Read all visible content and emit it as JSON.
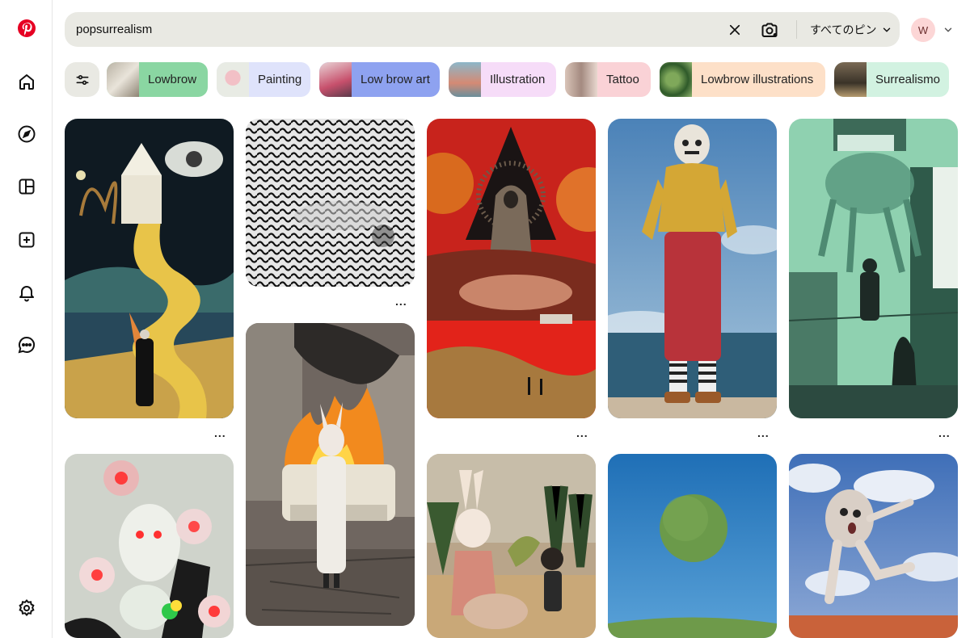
{
  "search": {
    "value": "popsurrealism",
    "filter_label": "すべてのピン"
  },
  "account": {
    "initial": "W"
  },
  "chips": [
    {
      "label": "Lowbrow",
      "color": "#8ad6a2"
    },
    {
      "label": "Painting",
      "color": "#dfe3fb"
    },
    {
      "label": "Low brow art",
      "color": "#8ea2f0"
    },
    {
      "label": "Illustration",
      "color": "#f6dcf8"
    },
    {
      "label": "Tattoo",
      "color": "#fad2d6"
    },
    {
      "label": "Lowbrow illustrations",
      "color": "#fde0c8"
    },
    {
      "label": "Surrealismo",
      "color": "#d2f2e1"
    }
  ],
  "pin_more": "...",
  "colors": {
    "brand": "#e60023",
    "search_bg": "#e9e9e3"
  },
  "icons": [
    "pinterest-logo-icon",
    "home-icon",
    "compass-icon",
    "boards-icon",
    "create-icon",
    "bell-icon",
    "messages-icon",
    "settings-icon",
    "close-icon",
    "camera-search-icon",
    "chevron-down-icon",
    "filter-sliders-icon"
  ]
}
